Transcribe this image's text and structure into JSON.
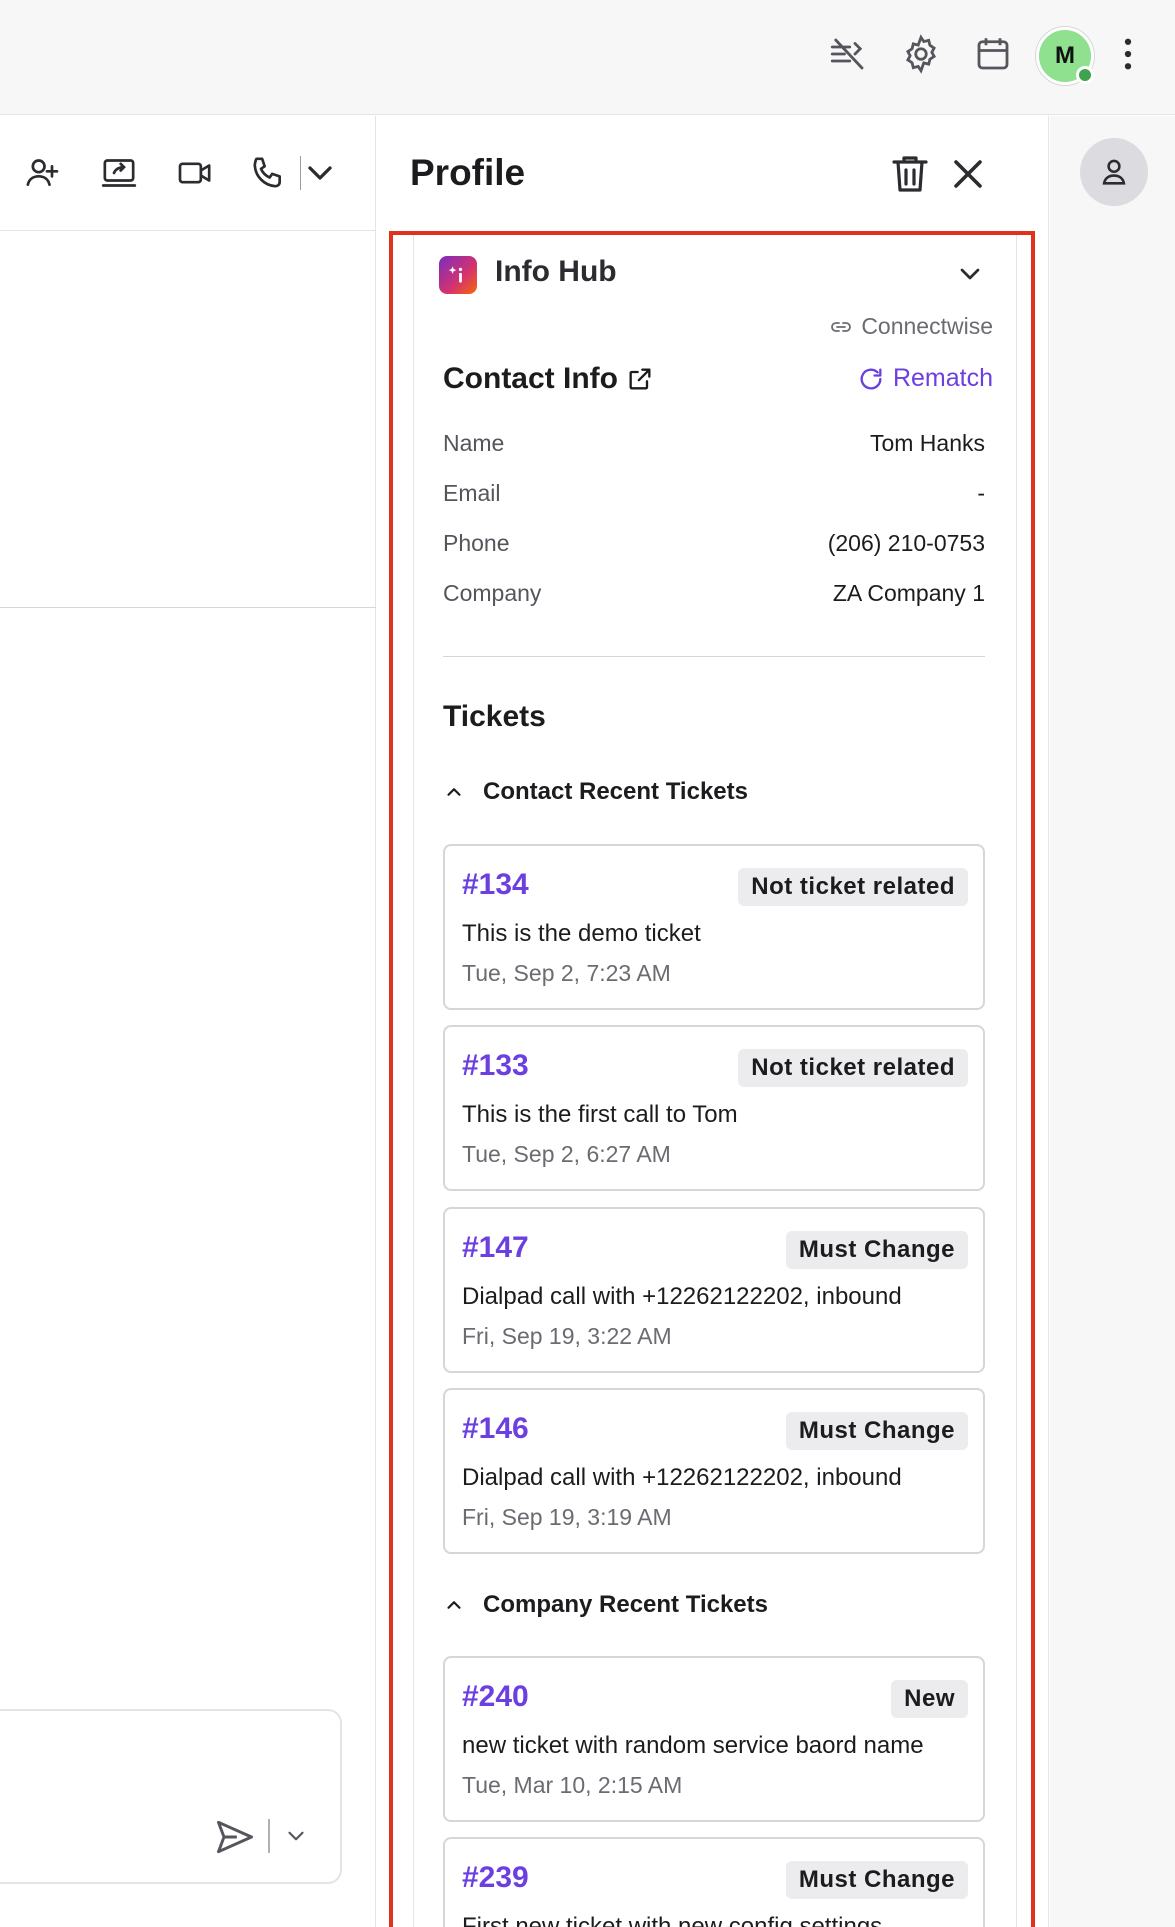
{
  "topbar": {
    "icons": [
      "connection-off-icon",
      "gear-icon",
      "calendar-icon"
    ],
    "user_initial": "M",
    "presence_color": "#3fa34d",
    "avatar_color": "#8fe08f"
  },
  "left_toolbar": {
    "icons": [
      "add-person-icon",
      "share-screen-icon",
      "video-icon",
      "phone-icon",
      "chevron-down-icon"
    ]
  },
  "profile": {
    "title": "Profile"
  },
  "info_hub": {
    "title": "Info Hub",
    "crm_source": "Connectwise",
    "contact_info_title": "Contact Info",
    "rematch_label": "Rematch",
    "fields": [
      {
        "label": "Name",
        "value": "Tom Hanks"
      },
      {
        "label": "Email",
        "value": "-"
      },
      {
        "label": "Phone",
        "value": "(206) 210-0753"
      },
      {
        "label": "Company",
        "value": "ZA Company 1"
      }
    ]
  },
  "tickets": {
    "title": "Tickets",
    "contact_group": {
      "label": "Contact Recent Tickets",
      "items": [
        {
          "number": "#134",
          "status": "Not ticket related",
          "subject": "This is the demo ticket",
          "date": "Tue, Sep 2, 7:23 AM"
        },
        {
          "number": "#133",
          "status": "Not ticket related",
          "subject": "This is the first call to Tom",
          "date": "Tue, Sep 2, 6:27 AM"
        },
        {
          "number": "#147",
          "status": "Must Change",
          "subject": "Dialpad call with +12262122202, inbound",
          "date": "Fri, Sep 19, 3:22 AM"
        },
        {
          "number": "#146",
          "status": "Must Change",
          "subject": "Dialpad call with +12262122202, inbound",
          "date": "Fri, Sep 19, 3:19 AM"
        }
      ]
    },
    "company_group": {
      "label": "Company Recent Tickets",
      "items": [
        {
          "number": "#240",
          "status": "New",
          "subject": "new ticket with random service baord name",
          "date": "Tue, Mar 10, 2:15 AM"
        },
        {
          "number": "#239",
          "status": "Must Change",
          "subject": "First new ticket with new config settings",
          "date": ""
        }
      ]
    }
  },
  "colors": {
    "accent": "#6b3fe0",
    "highlight_border": "#e0301e"
  }
}
